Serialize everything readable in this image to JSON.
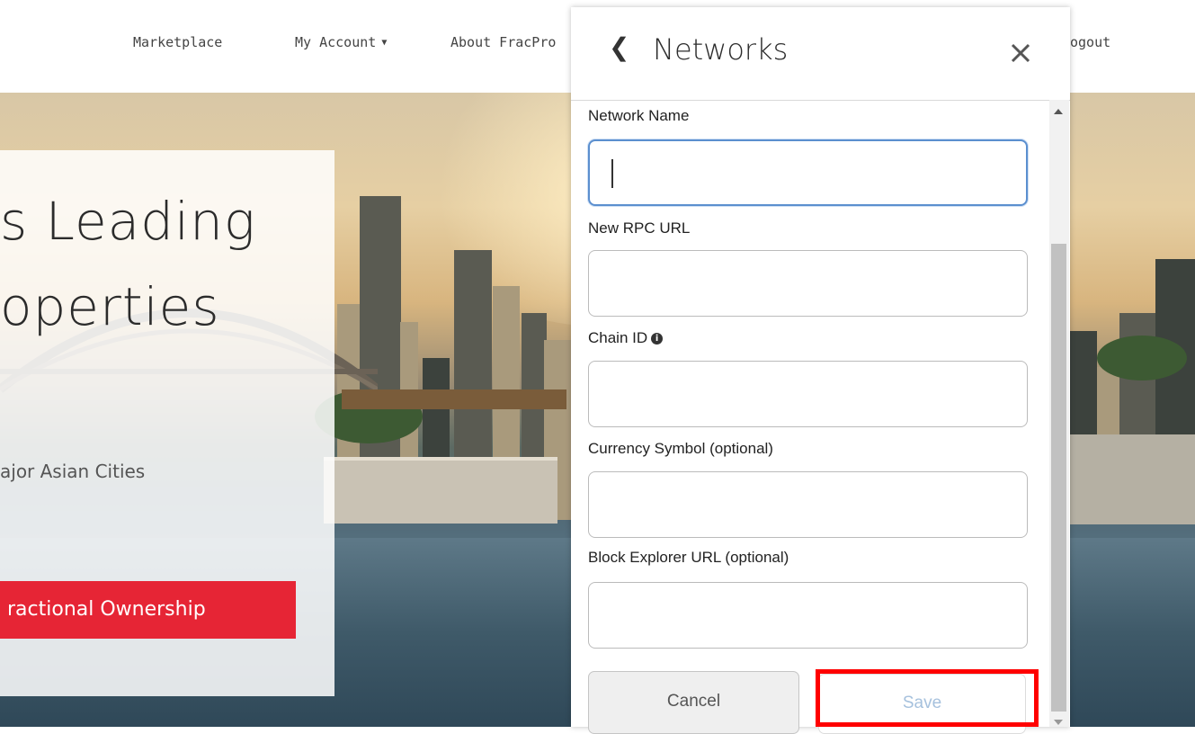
{
  "nav": {
    "marketplace": "Marketplace",
    "my_account": "My Account",
    "about": "About FracPro",
    "logout": "ogout"
  },
  "hero": {
    "line1": "s Leading",
    "line2": "operties",
    "subtitle": "ajor Asian Cities",
    "cta": "ractional Ownership"
  },
  "modal": {
    "title": "Networks",
    "fields": [
      {
        "label": "Network Name",
        "value": ""
      },
      {
        "label": "New RPC URL",
        "value": ""
      },
      {
        "label": "Chain ID",
        "value": ""
      },
      {
        "label": "Currency Symbol (optional)",
        "value": ""
      },
      {
        "label": "Block Explorer URL (optional)",
        "value": ""
      }
    ],
    "cancel_label": "Cancel",
    "save_label": "Save"
  },
  "colors": {
    "cta_red": "#e62535",
    "focus_blue": "#5b8fcf",
    "save_text": "#a6c1dd",
    "highlight": "#ff0000"
  }
}
